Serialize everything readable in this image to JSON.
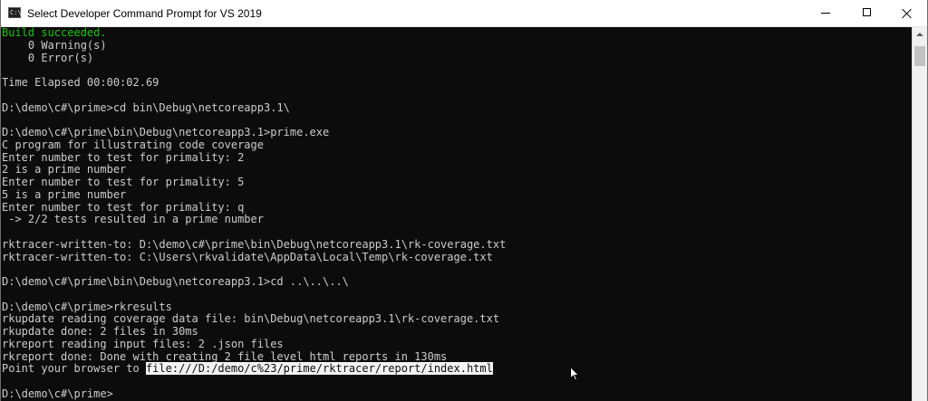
{
  "window": {
    "title": "Select Developer Command Prompt for VS 2019",
    "icon": "cmd-icon",
    "controls": {
      "minimize": "minimize-icon",
      "maximize": "maximize-icon",
      "close": "close-icon"
    }
  },
  "colors": {
    "console_bg": "#0c0c0c",
    "console_text": "#cccccc",
    "success_text": "#16c60c",
    "selection_bg": "#f2f2f2"
  },
  "console": {
    "lines": [
      "Build succeeded.",
      "    0 Warning(s)",
      "    0 Error(s)",
      "",
      "Time Elapsed 00:00:02.69",
      "",
      "D:\\demo\\c#\\prime>cd bin\\Debug\\netcoreapp3.1\\",
      "",
      "D:\\demo\\c#\\prime\\bin\\Debug\\netcoreapp3.1>prime.exe",
      "C program for illustrating code coverage",
      "Enter number to test for primality: 2",
      "2 is a prime number",
      "Enter number to test for primality: 5",
      "5 is a prime number",
      "Enter number to test for primality: q",
      " -> 2/2 tests resulted in a prime number",
      "",
      "rktracer-written-to: D:\\demo\\c#\\prime\\bin\\Debug\\netcoreapp3.1\\rk-coverage.txt",
      "rktracer-written-to: C:\\Users\\rkvalidate\\AppData\\Local\\Temp\\rk-coverage.txt",
      "",
      "D:\\demo\\c#\\prime\\bin\\Debug\\netcoreapp3.1>cd ..\\..\\..\\",
      "",
      "D:\\demo\\c#\\prime>rkresults",
      "rkupdate reading coverage data file: bin\\Debug\\netcoreapp3.1\\rk-coverage.txt",
      "rkupdate done: 2 files in 30ms",
      "rkreport reading input files: 2 .json files",
      "rkreport done: Done with creating 2 file level html reports in 130ms",
      "",
      "",
      "D:\\demo\\c#\\prime>"
    ],
    "browser_line_prefix": "Point your browser to ",
    "browser_line_link": "file:///D:/demo/c%23/prime/rktracer/report/index.html"
  },
  "scrollbar": {
    "up_icon": "chevron-up-icon"
  }
}
